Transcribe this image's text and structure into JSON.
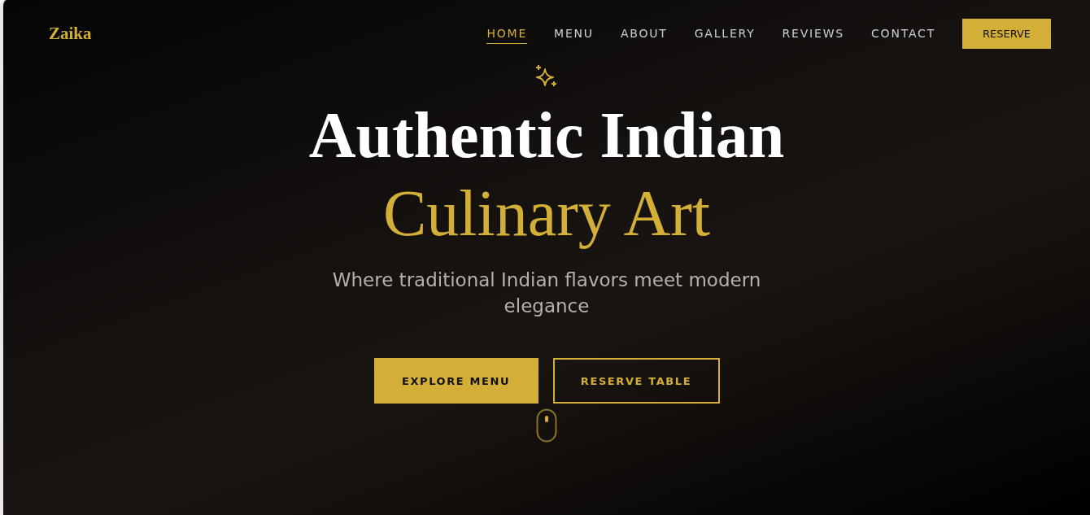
{
  "brand": "Zaika",
  "nav": [
    {
      "label": "HOME",
      "selected": true
    },
    {
      "label": "MENU",
      "selected": false
    },
    {
      "label": "ABOUT",
      "selected": false
    },
    {
      "label": "GALLERY",
      "selected": false
    },
    {
      "label": "REVIEWS",
      "selected": false
    },
    {
      "label": "CONTACT",
      "selected": false
    }
  ],
  "nav_button": "RESERVE",
  "hero": {
    "title_line_1": "Authentic Indian",
    "title_line_2": "Culinary Art",
    "subtitle": "Where traditional Indian flavors meet modern elegance",
    "buttons": [
      {
        "label": "EXPLORE MENU",
        "kind": "primary"
      },
      {
        "label": "RESERVE TABLE",
        "kind": "outline"
      }
    ]
  }
}
